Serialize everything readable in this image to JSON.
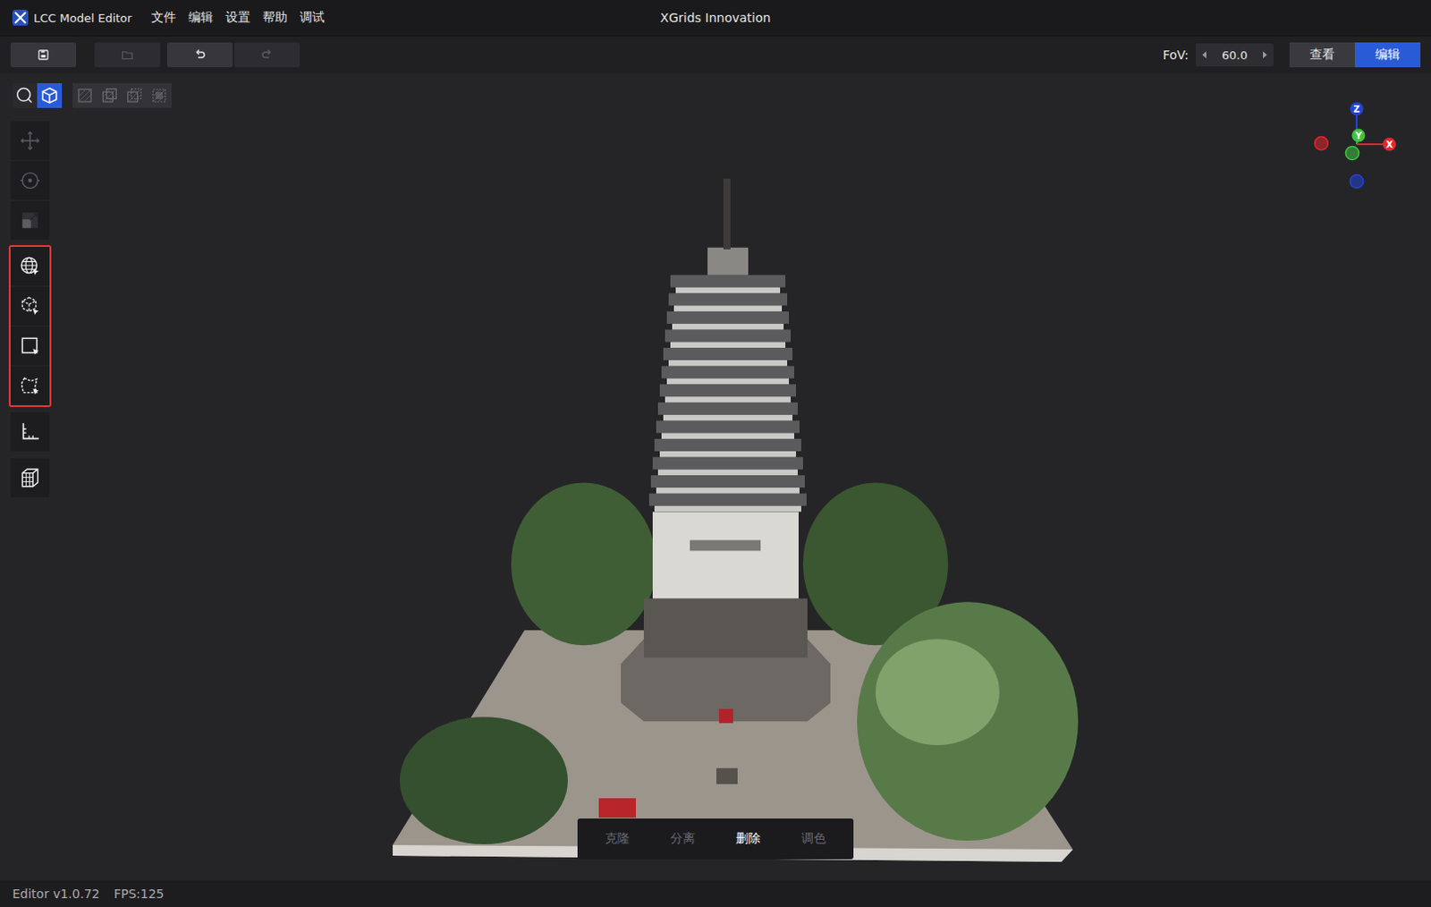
{
  "app": {
    "name": "LCC Model Editor",
    "title": "XGrids Innovation"
  },
  "menu": [
    "文件",
    "编辑",
    "设置",
    "帮助",
    "调试"
  ],
  "toolbar": {
    "buttons": [
      {
        "name": "save",
        "disabled": false
      },
      {
        "name": "open",
        "disabled": true
      },
      {
        "name": "undo",
        "disabled": false
      },
      {
        "name": "redo",
        "disabled": true
      }
    ]
  },
  "fov": {
    "label": "FoV:",
    "value": "60.0"
  },
  "modes": [
    {
      "label": "查看",
      "selected": false
    },
    {
      "label": "编辑",
      "selected": true
    }
  ],
  "view_modes": [
    {
      "name": "point-cloud",
      "selected": false
    },
    {
      "name": "cube",
      "selected": true
    }
  ],
  "render_modes": [
    {
      "name": "solid"
    },
    {
      "name": "overlap"
    },
    {
      "name": "subtract"
    },
    {
      "name": "intersect"
    }
  ],
  "tool_groups": [
    {
      "highlighted": false,
      "tools": [
        {
          "name": "move",
          "disabled": true
        },
        {
          "name": "rotate",
          "disabled": true
        },
        {
          "name": "scale",
          "disabled": true
        }
      ]
    },
    {
      "highlighted": true,
      "tools": [
        {
          "name": "sphere-select",
          "disabled": false
        },
        {
          "name": "box-select",
          "disabled": false
        },
        {
          "name": "rect-select",
          "disabled": false
        },
        {
          "name": "polygon-select",
          "disabled": false
        }
      ]
    },
    {
      "highlighted": false,
      "tools": [
        {
          "name": "measure",
          "disabled": false
        }
      ]
    },
    {
      "highlighted": false,
      "tools": [
        {
          "name": "bounding-box",
          "disabled": false
        }
      ]
    }
  ],
  "gizmo": {
    "axes": [
      {
        "label": "Z",
        "color": "#2343d6"
      },
      {
        "label": "Y",
        "color": "#3ec43e"
      },
      {
        "label": "X",
        "color": "#e4262c"
      }
    ]
  },
  "actions": [
    {
      "label": "克隆",
      "disabled": true
    },
    {
      "label": "分离",
      "disabled": true
    },
    {
      "label": "删除",
      "disabled": false
    },
    {
      "label": "调色",
      "disabled": true
    }
  ],
  "status_bar": {
    "version": "Editor v1.0.72",
    "fps": "FPS:125"
  }
}
